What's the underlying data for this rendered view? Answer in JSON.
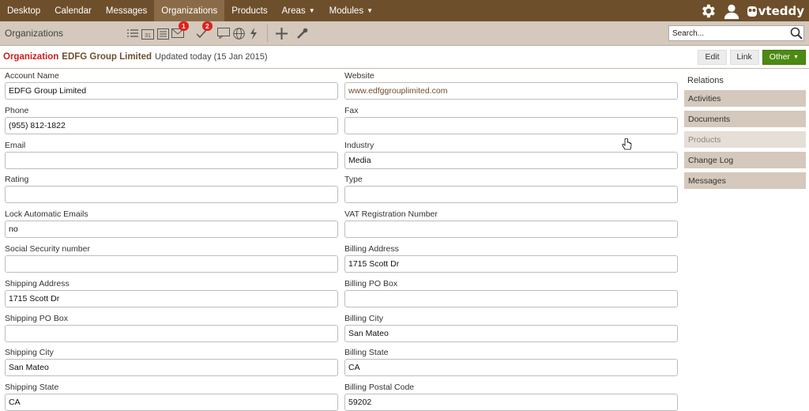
{
  "nav": {
    "items": [
      "Desktop",
      "Calendar",
      "Messages",
      "Organizations",
      "Products"
    ],
    "areas_label": "Areas",
    "modules_label": "Modules",
    "brand": "vteddy"
  },
  "toolbar": {
    "module_title": "Organizations",
    "mail_badge": "1",
    "task_badge": "2",
    "search_placeholder": "Search..."
  },
  "record": {
    "kind": "Organization",
    "name": "EDFG Group Limited",
    "updated": "Updated today (15 Jan 2015)",
    "buttons": {
      "edit": "Edit",
      "link": "Link",
      "other": "Other"
    }
  },
  "fields": {
    "left": [
      {
        "label": "Account Name",
        "value": "EDFG Group Limited"
      },
      {
        "label": "Phone",
        "value": "(955) 812-1822"
      },
      {
        "label": "Email",
        "value": ""
      },
      {
        "label": "Rating",
        "value": ""
      },
      {
        "label": "Lock Automatic Emails",
        "value": "no"
      },
      {
        "label": "Social Security number",
        "value": ""
      },
      {
        "label": "Shipping Address",
        "value": "1715 Scott Dr"
      },
      {
        "label": "Shipping PO Box",
        "value": ""
      },
      {
        "label": "Shipping City",
        "value": "San Mateo"
      },
      {
        "label": "Shipping State",
        "value": "CA"
      }
    ],
    "right": [
      {
        "label": "Website",
        "value": "www.edfggrouplimited.com"
      },
      {
        "label": "Fax",
        "value": ""
      },
      {
        "label": "Industry",
        "value": "Media"
      },
      {
        "label": "Type",
        "value": ""
      },
      {
        "label": "VAT Registration Number",
        "value": ""
      },
      {
        "label": "Billing Address",
        "value": "1715 Scott Dr"
      },
      {
        "label": "Billing PO Box",
        "value": ""
      },
      {
        "label": "Billing City",
        "value": "San Mateo"
      },
      {
        "label": "Billing State",
        "value": "CA"
      },
      {
        "label": "Billing Postal Code",
        "value": "59202"
      }
    ]
  },
  "relations": {
    "heading": "Relations",
    "items": [
      "Activities",
      "Documents",
      "Products",
      "Change Log",
      "Messages"
    ],
    "disabled": "Products"
  },
  "colors": {
    "nav_bg": "#6e4f2c",
    "toolbar_bg": "#d4c9bc",
    "accent_red": "#c8201b",
    "other_green": "#4d8a12"
  }
}
